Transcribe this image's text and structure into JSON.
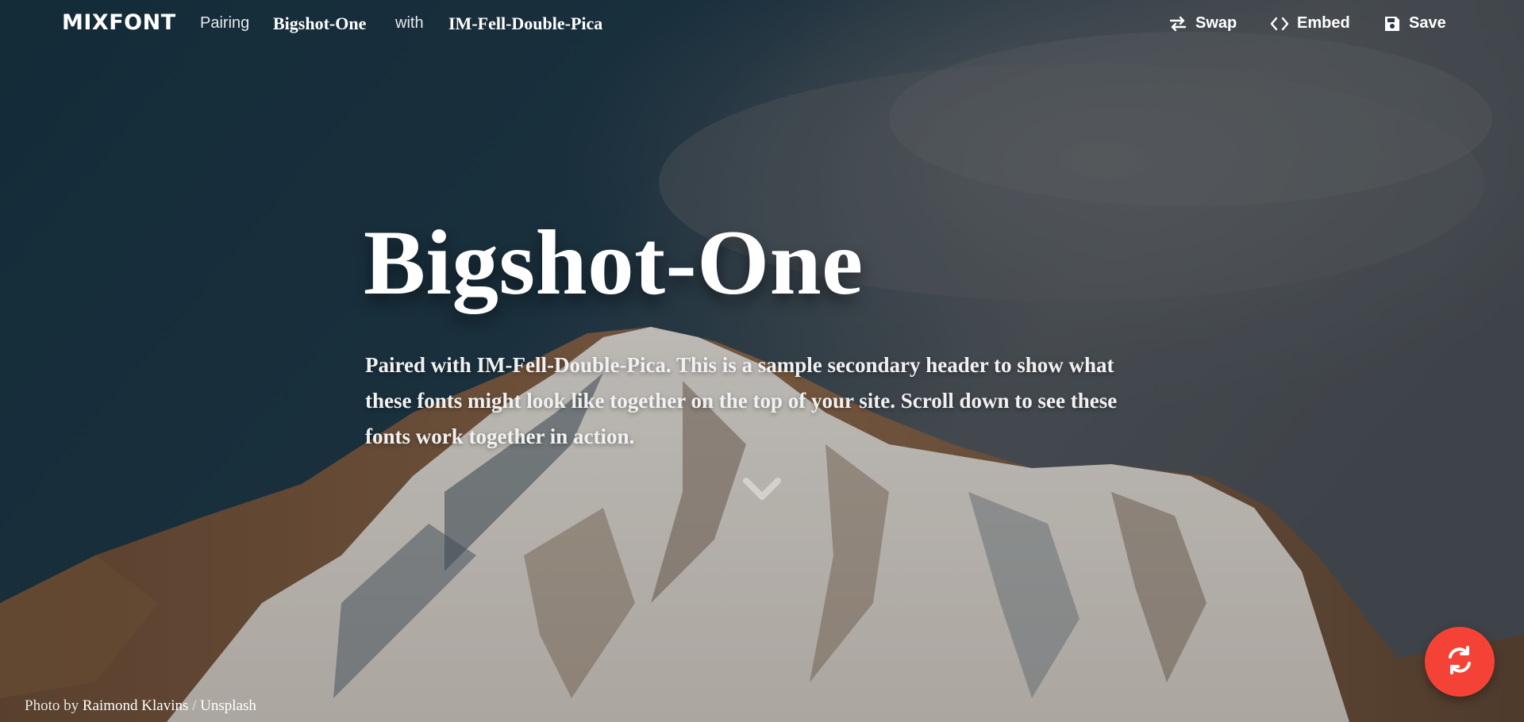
{
  "header": {
    "logo": "MIXFONT",
    "pairing_label": "Pairing",
    "primary_font": "Bigshot-One",
    "with_label": "with",
    "secondary_font": "IM-Fell-Double-Pica",
    "actions": [
      {
        "label": "Swap",
        "icon": "swap-icon"
      },
      {
        "label": "Embed",
        "icon": "code-icon"
      },
      {
        "label": "Save",
        "icon": "floppy-disk-icon"
      }
    ]
  },
  "hero": {
    "title": "Bigshot-One",
    "subtitle": "Paired with IM-Fell-Double-Pica. This is a sample secondary header to show what these fonts might look like together on the top of your site. Scroll down to see these fonts work together in action.",
    "scroll_icon": "chevron-down-icon"
  },
  "credit": {
    "prefix": "Photo by",
    "author": "Raimond Klavins",
    "separator": "/",
    "source": "Unsplash"
  },
  "fab": {
    "icon": "refresh-icon",
    "color": "#f44336"
  },
  "colors": {
    "sky": "#1c3342",
    "snow": "#e9e6e1",
    "rock": "#7a5538",
    "accent": "#f44336"
  }
}
